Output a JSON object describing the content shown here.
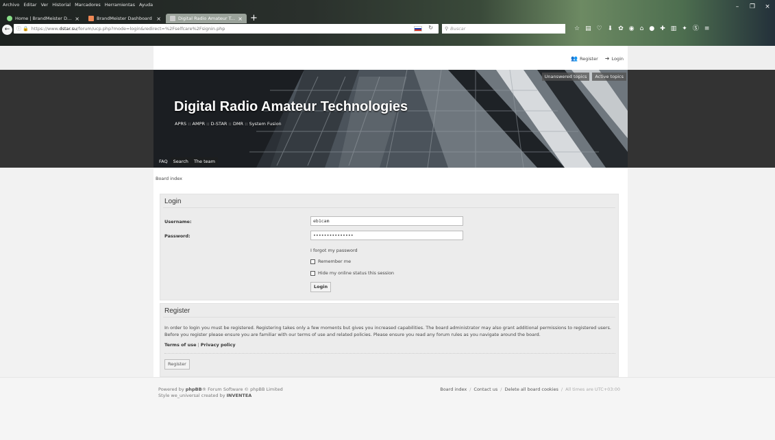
{
  "browser": {
    "menu": [
      "Archivo",
      "Editar",
      "Ver",
      "Historial",
      "Marcadores",
      "Herramientas",
      "Ayuda"
    ],
    "window_controls": [
      "–",
      "❐",
      "×"
    ],
    "tabs": [
      {
        "title": "Home | BrandMeister DM...",
        "active": false
      },
      {
        "title": "BrandMeister Dashboard",
        "active": false
      },
      {
        "title": "Digital Radio Amateur Techno...",
        "active": true
      }
    ],
    "url_prefix": "https://www.",
    "url_domain": "dstar.su",
    "url_path": "/forum/ucp.php?mode=login&redirect=%2Fselfcare%2Fsignin.php",
    "search_placeholder": "Buscar"
  },
  "forum": {
    "top_links": {
      "register": "Register",
      "login": "Login"
    },
    "title": "Digital Radio Amateur Technologies",
    "subtitle": "APRS :: AMPR :: D-STAR :: DMR :: System Fusion",
    "header_buttons": [
      "Unanswered topics",
      "Active topics"
    ],
    "nav": [
      "FAQ",
      "Search",
      "The team"
    ],
    "breadcrumb": "Board index"
  },
  "login": {
    "heading": "Login",
    "username_label": "Username:",
    "username_value": "eb1cam",
    "password_label": "Password:",
    "password_value": "•••••••••••••••",
    "forgot": "I forgot my password",
    "remember": "Remember me",
    "hide_status": "Hide my online status this session",
    "submit": "Login"
  },
  "register": {
    "heading": "Register",
    "text": "In order to login you must be registered. Registering takes only a few moments but gives you increased capabilities. The board administrator may also grant additional permissions to registered users. Before you register please ensure you are familiar with our terms of use and related policies. Please ensure you read any forum rules as you navigate around the board.",
    "terms": "Terms of use",
    "privacy": "Privacy policy",
    "button": "Register"
  },
  "footer": {
    "powered_pre": "Powered by ",
    "powered_brand": "phpBB",
    "powered_post": "® Forum Software © phpBB Limited",
    "style_pre": "Style we_universal created by ",
    "style_author": "INVENTEA",
    "links": [
      "Board index",
      "Contact us",
      "Delete all board cookies"
    ],
    "timezone": "All times are UTC+03:00"
  }
}
